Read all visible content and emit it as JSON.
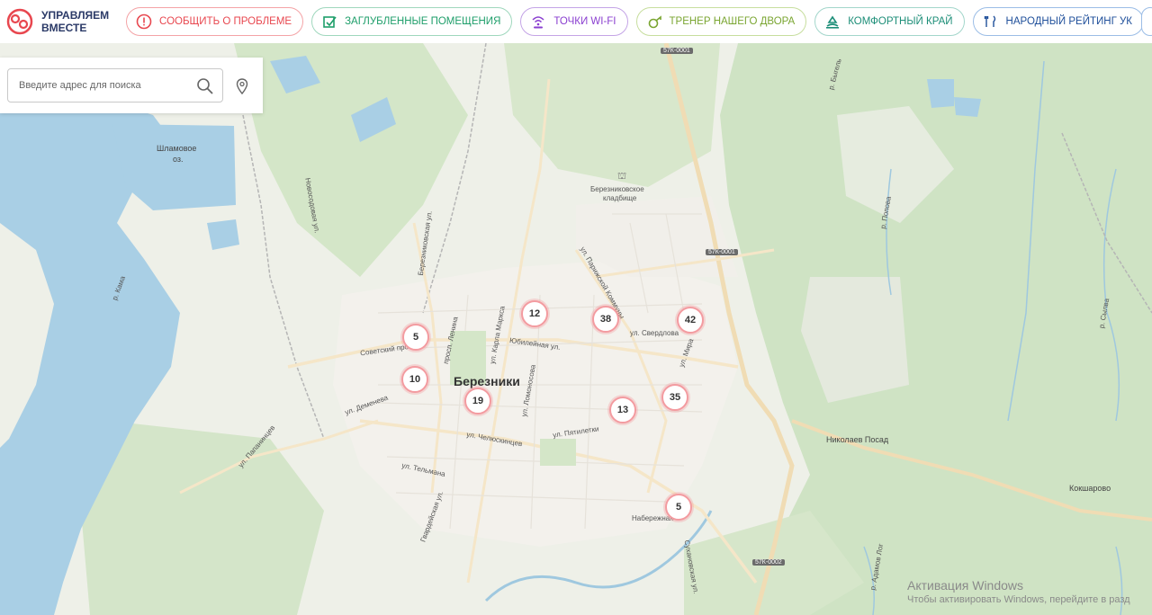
{
  "header": {
    "logo_line1": "УПРАВЛЯЕМ",
    "logo_line2": "ВМЕСТЕ",
    "nav": [
      {
        "label": "СООБЩИТЬ О ПРОБЛЕМЕ",
        "icon": "alert-icon",
        "color": "#e8474f"
      },
      {
        "label": "ЗАГЛУБЛЕННЫЕ ПОМЕЩЕНИЯ",
        "icon": "shelter-icon",
        "color": "#1e9e6a"
      },
      {
        "label": "ТОЧКИ WI-FI",
        "icon": "wifi-icon",
        "color": "#8a3fd0"
      },
      {
        "label": "ТРЕНЕР НАШЕГО ДВОРА",
        "icon": "whistle-icon",
        "color": "#7aa531"
      },
      {
        "label": "КОМФОРТНЫЙ КРАЙ",
        "icon": "comfort-icon",
        "color": "#1d8e78"
      },
      {
        "label": "НАРОДНЫЙ РЕЙТИНГ УК",
        "icon": "rating-icon",
        "color": "#1f4f9a"
      }
    ]
  },
  "search": {
    "placeholder": "Введите адрес для поиска"
  },
  "map": {
    "city": "Березники",
    "places": [
      "Шламовое",
      "оз.",
      "Березниковское",
      "кладбище",
      "Николаев Посад",
      "Кокшарово"
    ],
    "streets": [
      "ул. Свердлова",
      "ул. Мира",
      "Юбилейная ул.",
      "Советский просп.",
      "ул. Пятилетки",
      "ул. Челюскинцев",
      "ул. Тельмана",
      "ул. Деменева",
      "ул. Ломоносова",
      "ул. Карла Маркса",
      "просп. Ленина",
      "Березниковская ул.",
      "Новосодовая ул.",
      "ул. Парижской Коммуны",
      "ул. Папанинцев",
      "Гвардейская ул.",
      "Набережная",
      "Сухановская ул.",
      "р. Кама",
      "р. Быгель",
      "р. Попова",
      "р. Сылва",
      "р. Адамов Лог"
    ],
    "roads": [
      "57К-0001",
      "57К-0001",
      "57К-0002"
    ],
    "clusters": [
      {
        "count": "12"
      },
      {
        "count": "38"
      },
      {
        "count": "42"
      },
      {
        "count": "5"
      },
      {
        "count": "10"
      },
      {
        "count": "19"
      },
      {
        "count": "13"
      },
      {
        "count": "35"
      },
      {
        "count": "5"
      }
    ]
  },
  "watermark": {
    "line1": "Активация Windows",
    "line2": "Чтобы активировать Windows, перейдите в разд"
  }
}
